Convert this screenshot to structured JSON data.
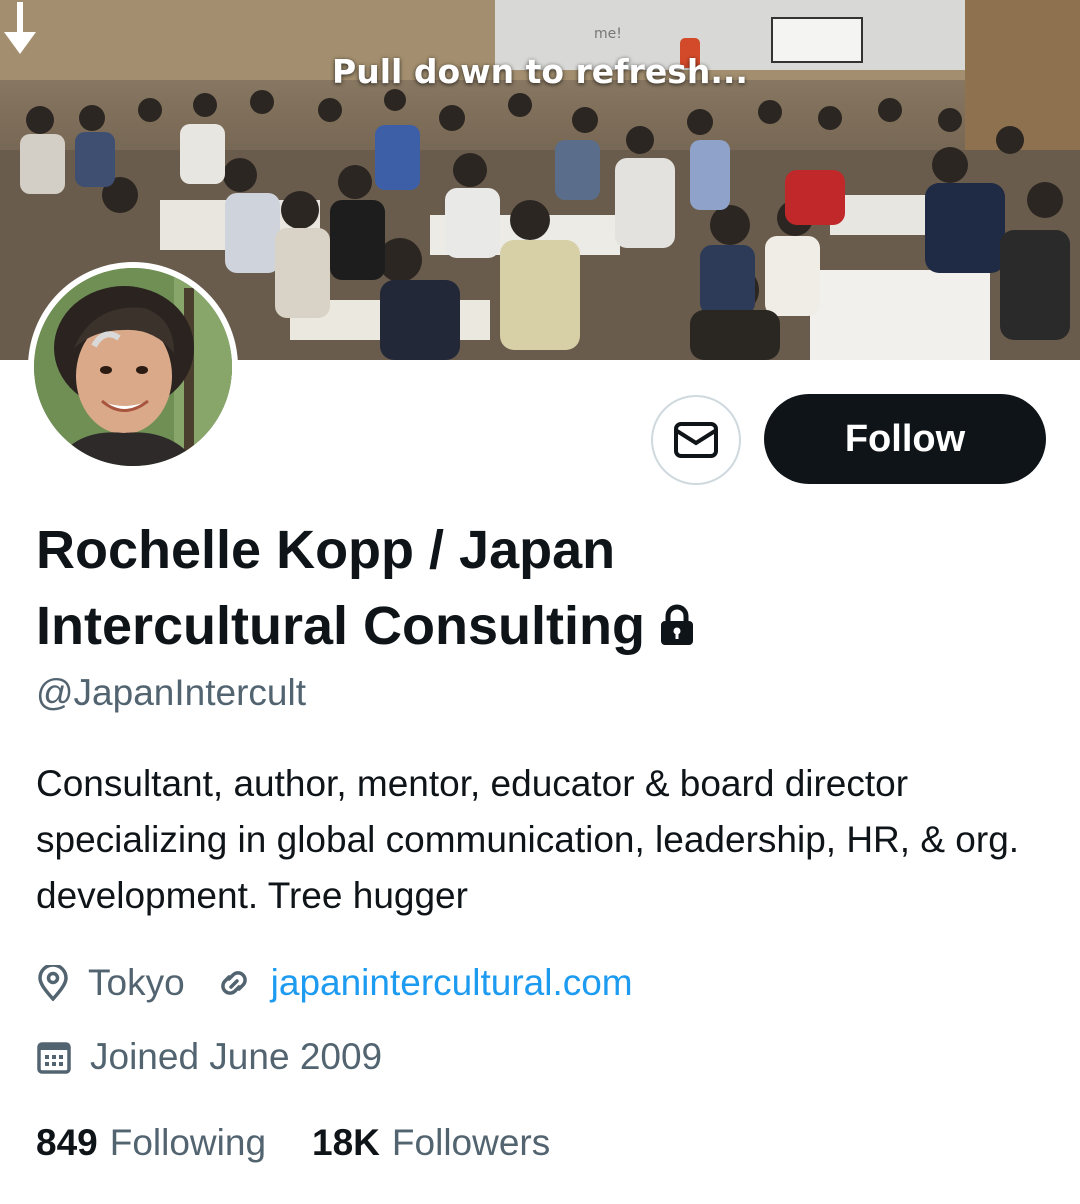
{
  "banner": {
    "refresh_text": "Pull down to refresh...",
    "note_text": "me!"
  },
  "actions": {
    "message_icon": "mail-icon",
    "follow_label": "Follow"
  },
  "profile": {
    "display_name": "Rochelle Kopp / Japan Intercultural Consulting",
    "protected_icon": "lock-icon",
    "handle": "@JapanIntercult",
    "bio": "Consultant, author, mentor, educator & board director specializing in global communication, leadership, HR, & org. development. Tree hugger",
    "location": "Tokyo",
    "website": "japanintercultural.com",
    "joined": "Joined June 2009"
  },
  "stats": {
    "following_count": "849",
    "following_label": "Following",
    "followers_count": "18K",
    "followers_label": "Followers"
  },
  "colors": {
    "text_primary": "#0f1419",
    "text_secondary": "#536471",
    "link": "#1d9bf0",
    "button_dark": "#0f1419",
    "border": "#cfd9de"
  }
}
